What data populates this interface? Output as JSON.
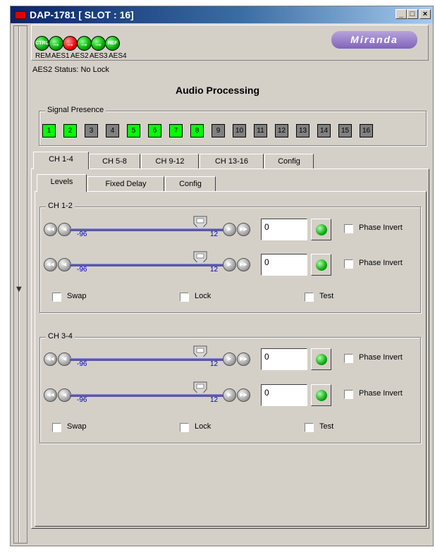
{
  "window": {
    "title": "DAP-1781 [ SLOT : 16]",
    "buttons": [
      "_",
      "□",
      "×"
    ]
  },
  "header": {
    "indicators": [
      {
        "label": "REM",
        "text": "CTRL",
        "color": "green"
      },
      {
        "label": "AES1",
        "text": "→",
        "color": "green"
      },
      {
        "label": "AES2",
        "text": "→",
        "color": "red"
      },
      {
        "label": "AES3",
        "text": "→",
        "color": "green"
      },
      {
        "label": "AES4",
        "text": "→",
        "color": "green"
      },
      {
        "label": "",
        "text": "REF",
        "color": "green"
      }
    ],
    "logo": "Miranda",
    "status": "AES2 Status: No Lock"
  },
  "heading": "Audio Processing",
  "signal_presence": {
    "label": "Signal Presence",
    "channels": [
      {
        "n": "1",
        "on": true
      },
      {
        "n": "2",
        "on": true
      },
      {
        "n": "3",
        "on": false
      },
      {
        "n": "4",
        "on": false
      },
      {
        "n": "5",
        "on": true
      },
      {
        "n": "6",
        "on": true
      },
      {
        "n": "7",
        "on": true
      },
      {
        "n": "8",
        "on": true
      },
      {
        "n": "9",
        "on": false
      },
      {
        "n": "10",
        "on": false
      },
      {
        "n": "11",
        "on": false
      },
      {
        "n": "12",
        "on": false
      },
      {
        "n": "13",
        "on": false
      },
      {
        "n": "14",
        "on": false
      },
      {
        "n": "15",
        "on": false
      },
      {
        "n": "16",
        "on": false
      }
    ]
  },
  "tabs": [
    {
      "label": "CH 1-4",
      "active": true
    },
    {
      "label": "CH 5-8",
      "active": false
    },
    {
      "label": "CH 9-12",
      "active": false
    },
    {
      "label": "CH 13-16",
      "active": false
    },
    {
      "label": "Config",
      "active": false
    }
  ],
  "subtabs": [
    {
      "label": "Levels",
      "active": true
    },
    {
      "label": "Fixed Delay",
      "active": false
    },
    {
      "label": "Config",
      "active": false
    }
  ],
  "groups": [
    {
      "label": "CH 1-2",
      "sliders": [
        {
          "min": "-96",
          "max": "12",
          "value": "0",
          "phase_label": "Phase Invert"
        },
        {
          "min": "-96",
          "max": "12",
          "value": "0",
          "phase_label": "Phase Invert"
        }
      ],
      "swap": "Swap",
      "lock": "Lock",
      "test": "Test"
    },
    {
      "label": "CH 3-4",
      "sliders": [
        {
          "min": "-96",
          "max": "12",
          "value": "0",
          "phase_label": "Phase Invert"
        },
        {
          "min": "-96",
          "max": "12",
          "value": "0",
          "phase_label": "Phase Invert"
        }
      ],
      "swap": "Swap",
      "lock": "Lock",
      "test": "Test"
    }
  ]
}
